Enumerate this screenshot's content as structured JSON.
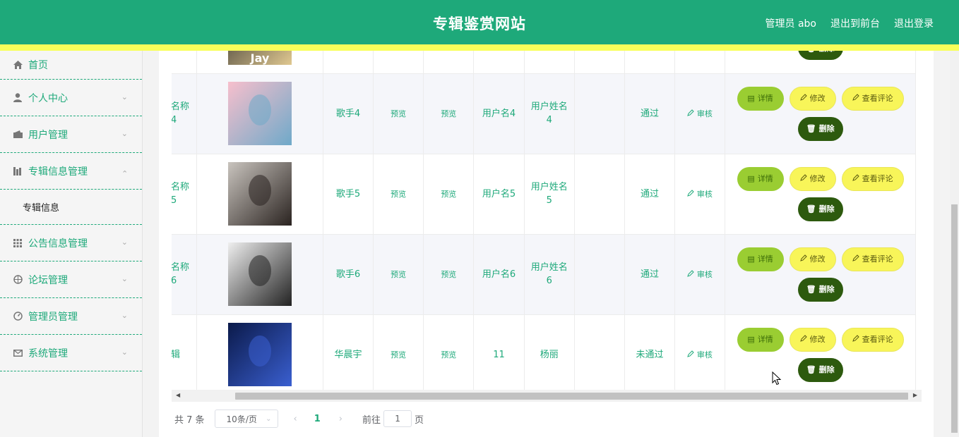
{
  "header": {
    "title": "专辑鉴赏网站",
    "admin_label": "管理员 abo",
    "to_front": "退出到前台",
    "logout": "退出登录"
  },
  "sidebar": {
    "items": [
      {
        "label": "首页",
        "icon": "home-icon"
      },
      {
        "label": "个人中心",
        "icon": "user-icon"
      },
      {
        "label": "用户管理",
        "icon": "wallet-icon"
      },
      {
        "label": "专辑信息管理",
        "icon": "chart-icon",
        "expanded": true,
        "children": [
          {
            "label": "专辑信息"
          }
        ]
      },
      {
        "label": "公告信息管理",
        "icon": "grid-icon"
      },
      {
        "label": "论坛管理",
        "icon": "compass-icon"
      },
      {
        "label": "管理员管理",
        "icon": "gauge-icon"
      },
      {
        "label": "系统管理",
        "icon": "mail-icon"
      }
    ]
  },
  "table": {
    "rows": [
      {
        "name": "",
        "singer": "",
        "preview1": "",
        "preview2": "",
        "username": "",
        "realname": "",
        "extra": "",
        "status": "",
        "audit": "",
        "partial": true,
        "image_colors": [
          "#2c2c2c",
          "#e0c890"
        ],
        "image_text": "Jay"
      },
      {
        "name": "名称\n4",
        "singer": "歌手4",
        "preview1": "预览",
        "preview2": "预览",
        "username": "用户名4",
        "realname": "用户姓名\n4",
        "extra": "",
        "status": "通过",
        "audit": "审核",
        "image_colors": [
          "#f7bfcc",
          "#6fa9c9"
        ]
      },
      {
        "name": "名称\n5",
        "singer": "歌手5",
        "preview1": "预览",
        "preview2": "预览",
        "username": "用户名5",
        "realname": "用户姓名\n5",
        "extra": "",
        "status": "通过",
        "audit": "审核",
        "image_colors": [
          "#c9c4be",
          "#2a2320"
        ]
      },
      {
        "name": "名称\n6",
        "singer": "歌手6",
        "preview1": "预览",
        "preview2": "预览",
        "username": "用户名6",
        "realname": "用户姓名\n6",
        "extra": "",
        "status": "通过",
        "audit": "审核",
        "image_colors": [
          "#efefef",
          "#222222"
        ]
      },
      {
        "name": "辑",
        "singer": "华晨宇",
        "preview1": "预览",
        "preview2": "预览",
        "username": "11",
        "realname": "杨丽",
        "extra": "",
        "status": "未通过",
        "audit": "审核",
        "image_colors": [
          "#0b1a4a",
          "#3a5fd0"
        ]
      }
    ],
    "actions": {
      "detail": "详情",
      "edit": "修改",
      "comment": "查看评论",
      "delete": "删除"
    }
  },
  "pagination": {
    "total": "共 7 条",
    "page_size": "10条/页",
    "current_page": "1",
    "goto_label": "前往",
    "goto_value": "1",
    "unit": "页"
  },
  "colors": {
    "primary": "#1ea97a",
    "accent_yellow": "#f8ff5a",
    "detail_btn": "#9acd32",
    "delete_btn": "#2d5a0e"
  }
}
